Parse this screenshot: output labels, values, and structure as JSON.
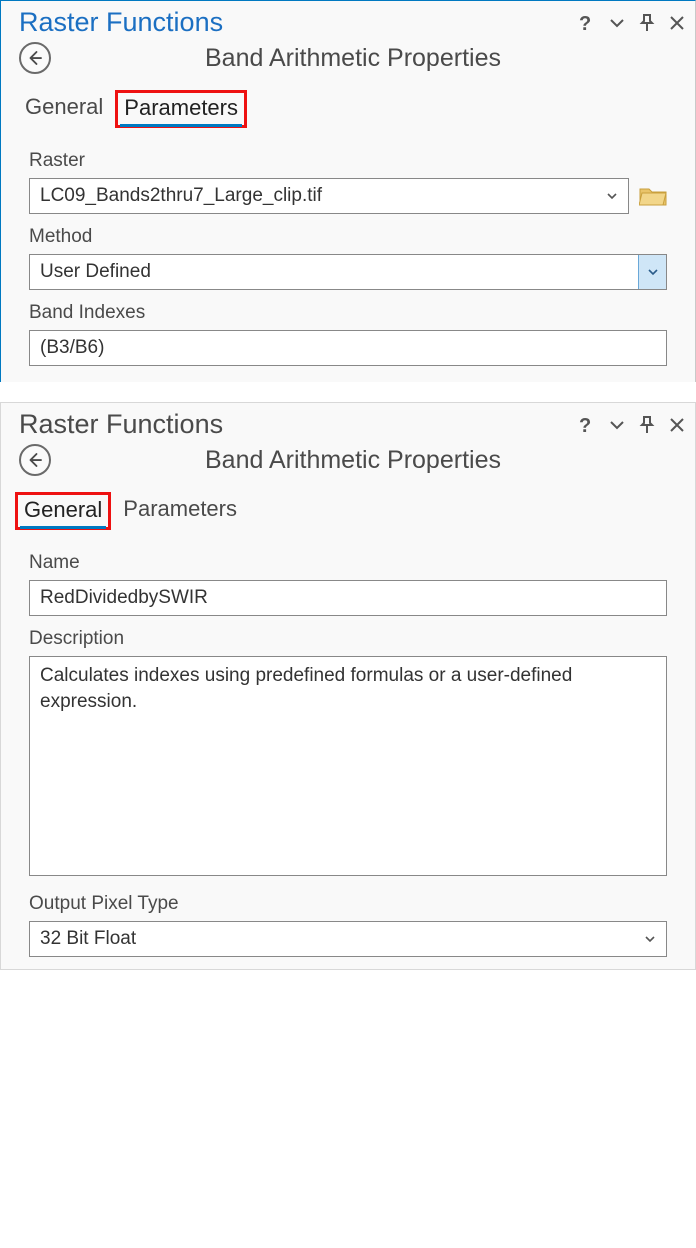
{
  "panel1": {
    "title": "Raster Functions",
    "subtitle": "Band Arithmetic Properties",
    "tabs": {
      "general": "General",
      "parameters": "Parameters"
    },
    "labels": {
      "raster": "Raster",
      "method": "Method",
      "band_indexes": "Band Indexes"
    },
    "values": {
      "raster": "LC09_Bands2thru7_Large_clip.tif",
      "method": "User Defined",
      "band_indexes": "(B3/B6)"
    }
  },
  "panel2": {
    "title": "Raster Functions",
    "subtitle": "Band Arithmetic Properties",
    "tabs": {
      "general": "General",
      "parameters": "Parameters"
    },
    "labels": {
      "name": "Name",
      "description": "Description",
      "output_pixel_type": "Output Pixel Type"
    },
    "values": {
      "name": "RedDividedbySWIR",
      "description": "Calculates indexes using predefined formulas or a user-defined expression.",
      "output_pixel_type": "32 Bit Float"
    }
  }
}
